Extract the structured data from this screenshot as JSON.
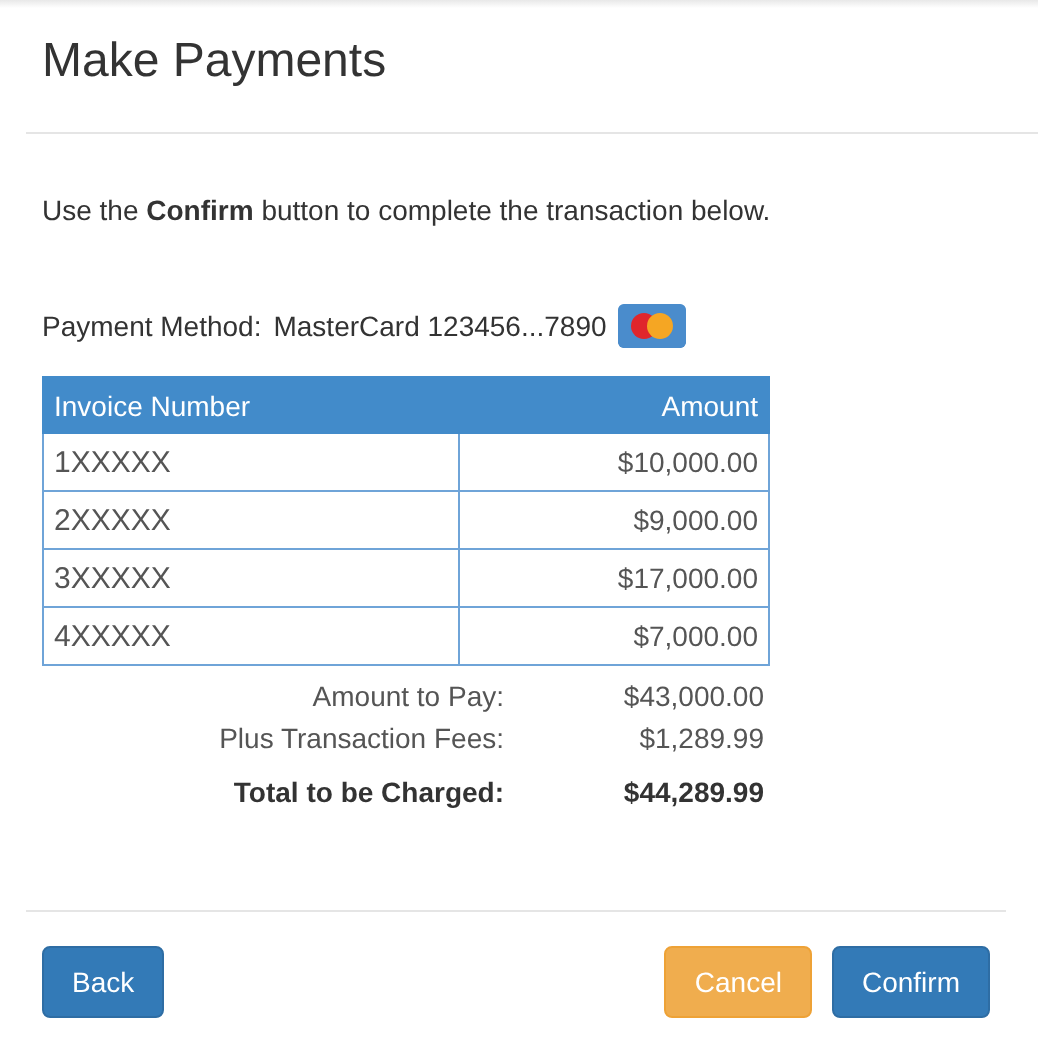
{
  "title": "Make Payments",
  "instruction": "Use the **Confirm** button to complete the transaction below.",
  "payment_method": {
    "label": "Payment Method:",
    "value": "MasterCard 123456...7890"
  },
  "table": {
    "columns": [
      "Invoice Number",
      "Amount"
    ],
    "rows": [
      {
        "invoice": "1XXXXX",
        "amount": "$10,000.00"
      },
      {
        "invoice": "2XXXXX",
        "amount": "$9,000.00"
      },
      {
        "invoice": "3XXXXX",
        "amount": "$17,000.00"
      },
      {
        "invoice": "4XXXXX",
        "amount": "$7,000.00"
      }
    ]
  },
  "summary": [
    {
      "label": "Amount to Pay:",
      "value": "$43,000.00",
      "kind": "normal"
    },
    {
      "label": "Plus Transaction Fees:",
      "value": "$1,289.99",
      "kind": "normal"
    },
    {
      "label": "Total to be Charged:",
      "value": "$44,289.99",
      "kind": "total"
    }
  ],
  "buttons": [
    {
      "label": "Back",
      "kind": "primary"
    },
    {
      "label": "Cancel",
      "kind": "warning"
    },
    {
      "label": "Confirm",
      "kind": "primary"
    }
  ]
}
